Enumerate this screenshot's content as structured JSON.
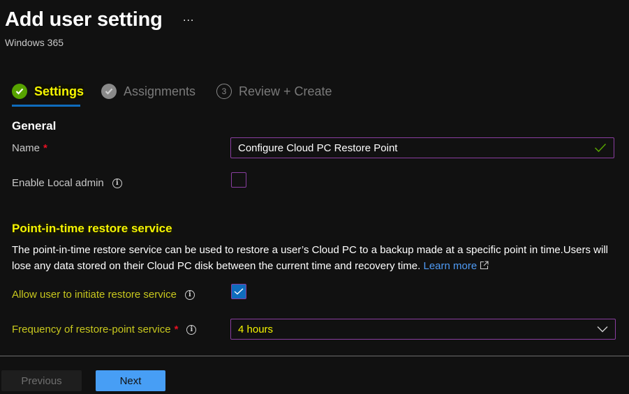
{
  "header": {
    "title": "Add user setting",
    "more_label": "···",
    "subtitle": "Windows 365"
  },
  "wizard": {
    "steps": [
      {
        "label": "Settings",
        "state": "active-complete",
        "icon": "check-circle-icon"
      },
      {
        "label": "Assignments",
        "state": "complete",
        "icon": "check-circle-icon"
      },
      {
        "label": "Review + Create",
        "state": "pending",
        "number": "3"
      }
    ]
  },
  "general": {
    "title": "General",
    "name_label": "Name",
    "required_marker": "*",
    "name_value": "Configure Cloud PC Restore Point",
    "local_admin_label": "Enable Local admin",
    "local_admin_checked": false
  },
  "pitr": {
    "title": "Point-in-time restore service",
    "description": "The point-in-time restore service can be used to restore a user’s Cloud PC to a backup made at a specific point in time.Users will lose any data stored on their Cloud PC disk between the current time and recovery time.",
    "learn_more": "Learn more",
    "allow_label": "Allow user to initiate restore service",
    "allow_checked": true,
    "frequency_label": "Frequency of restore-point service",
    "required_marker": "*",
    "frequency_value": "4 hours"
  },
  "footer": {
    "previous_label": "Previous",
    "next_label": "Next"
  },
  "colors": {
    "accent": "#0f6cbd",
    "success": "#57a300",
    "highlight": "#f5f500",
    "link": "#4f9bf5",
    "required": "#e81123",
    "input_border": "#8a3ea0",
    "primary_button": "#479ef5"
  }
}
